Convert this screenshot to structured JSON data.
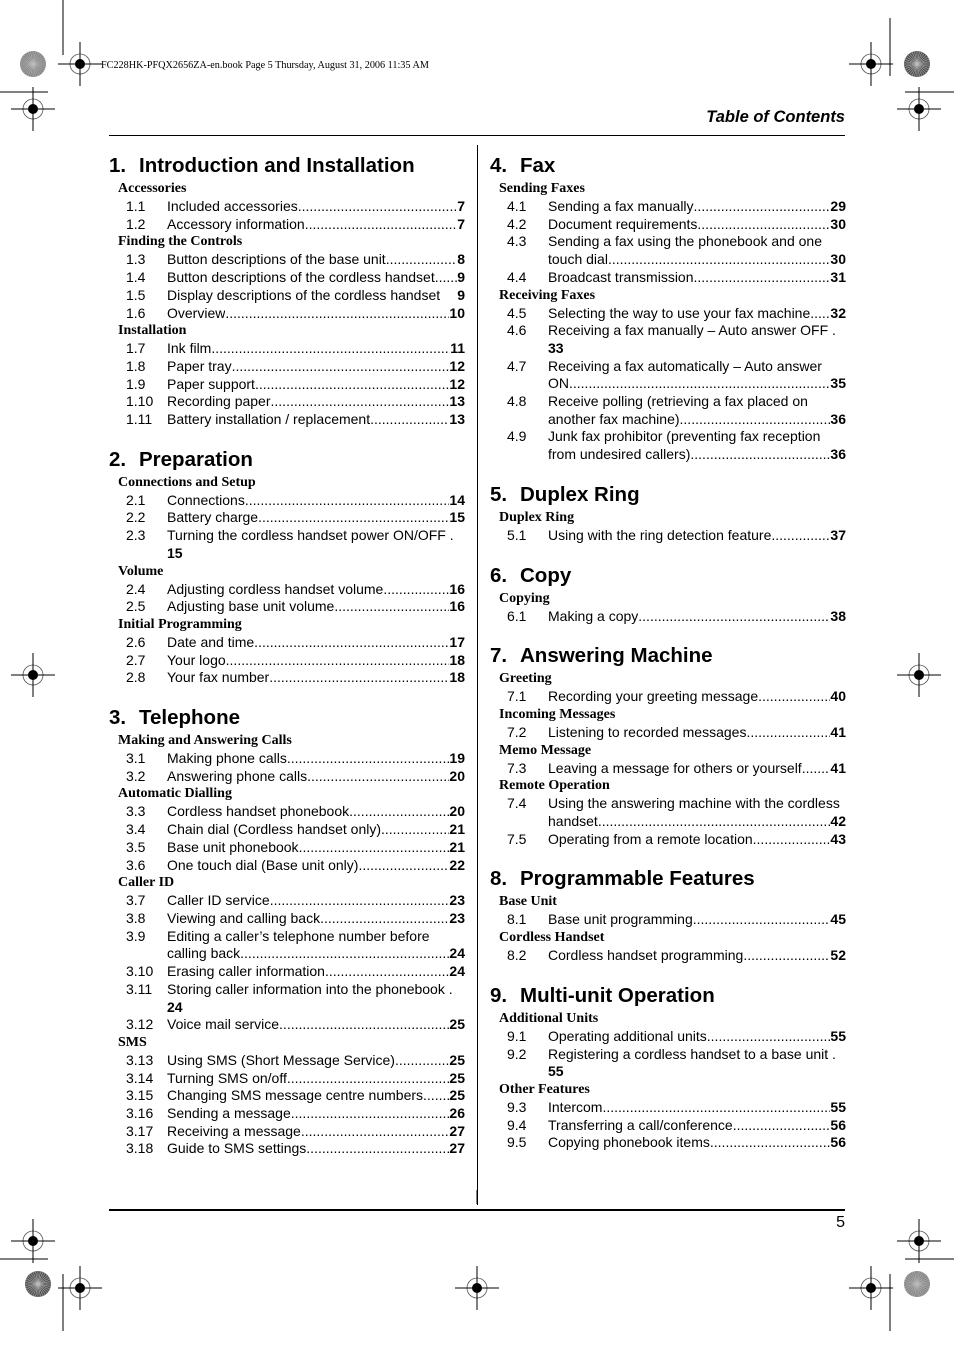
{
  "header": {
    "book_line": "FC228HK-PFQX2656ZA-en.book  Page 5  Thursday, August 31, 2006  11:35 AM",
    "title": "Table of Contents"
  },
  "footer": {
    "page_number": "5"
  },
  "left_column": [
    {
      "number": "1.",
      "title": "Introduction and Installation",
      "groups": [
        {
          "title": "Accessories",
          "entries": [
            {
              "no": "1.1",
              "text": "Included accessories",
              "page": "7"
            },
            {
              "no": "1.2",
              "text": "Accessory information",
              "page": "7"
            }
          ]
        },
        {
          "title": "Finding the Controls",
          "entries": [
            {
              "no": "1.3",
              "text": "Button descriptions of the base unit ",
              "page": "8"
            },
            {
              "no": "1.4",
              "text": "Button descriptions of the cordless handset",
              "page": "9"
            },
            {
              "no": "1.5",
              "text": "Display descriptions of the cordless handset ",
              "page": "9",
              "nodots": true
            },
            {
              "no": "1.6",
              "text": "Overview ",
              "page": "10"
            }
          ]
        },
        {
          "title": "Installation",
          "entries": [
            {
              "no": "1.7",
              "text": "Ink film",
              "page": "11"
            },
            {
              "no": "1.8",
              "text": "Paper tray ",
              "page": "12"
            },
            {
              "no": "1.9",
              "text": "Paper support",
              "page": "12"
            },
            {
              "no": "1.10",
              "text": "Recording paper",
              "page": "13"
            },
            {
              "no": "1.11",
              "text": "Battery installation / replacement ",
              "page": "13"
            }
          ]
        }
      ]
    },
    {
      "number": "2.",
      "title": "Preparation",
      "groups": [
        {
          "title": "Connections and Setup",
          "entries": [
            {
              "no": "2.1",
              "text": "Connections ",
              "page": "14"
            },
            {
              "no": "2.2",
              "text": "Battery charge",
              "page": "15"
            },
            {
              "no": "2.3",
              "text": "Turning the cordless handset power ON/OFF .",
              "page": "15",
              "page_next_line": true
            }
          ]
        },
        {
          "title": "Volume",
          "entries": [
            {
              "no": "2.4",
              "text": "Adjusting cordless handset volume ",
              "page": "16"
            },
            {
              "no": "2.5",
              "text": "Adjusting base unit volume",
              "page": "16"
            }
          ]
        },
        {
          "title": "Initial Programming",
          "entries": [
            {
              "no": "2.6",
              "text": "Date and time ",
              "page": "17"
            },
            {
              "no": "2.7",
              "text": "Your logo",
              "page": "18"
            },
            {
              "no": "2.8",
              "text": "Your fax number ",
              "page": "18"
            }
          ]
        }
      ]
    },
    {
      "number": "3.",
      "title": "Telephone",
      "groups": [
        {
          "title": "Making and Answering Calls",
          "entries": [
            {
              "no": "3.1",
              "text": "Making phone calls",
              "page": "19"
            },
            {
              "no": "3.2",
              "text": "Answering phone calls",
              "page": "20"
            }
          ]
        },
        {
          "title": "Automatic Dialling",
          "entries": [
            {
              "no": "3.3",
              "text": "Cordless handset phonebook",
              "page": "20"
            },
            {
              "no": "3.4",
              "text": "Chain dial (Cordless handset only) ",
              "page": "21"
            },
            {
              "no": "3.5",
              "text": "Base unit phonebook",
              "page": "21"
            },
            {
              "no": "3.6",
              "text": "One touch dial (Base unit only) ",
              "page": "22"
            }
          ]
        },
        {
          "title": "Caller ID",
          "entries": [
            {
              "no": "3.7",
              "text": "Caller ID service",
              "page": "23"
            },
            {
              "no": "3.8",
              "text": "Viewing and calling back ",
              "page": "23"
            },
            {
              "no": "3.9",
              "text": "Editing a caller’s telephone number before",
              "text2": "calling back",
              "page": "24"
            },
            {
              "no": "3.10",
              "text": "Erasing caller information",
              "page": "24"
            },
            {
              "no": "3.11",
              "text": "Storing caller information into the phonebook .",
              "page": "24",
              "page_next_line": true
            },
            {
              "no": "3.12",
              "text": "Voice mail service",
              "page": "25"
            }
          ]
        },
        {
          "title": "SMS",
          "entries": [
            {
              "no": "3.13",
              "text": "Using SMS (Short Message Service)",
              "page": "25"
            },
            {
              "no": "3.14",
              "text": "Turning SMS on/off",
              "page": "25"
            },
            {
              "no": "3.15",
              "text": "Changing SMS message centre numbers",
              "page": "25"
            },
            {
              "no": "3.16",
              "text": "Sending a message",
              "page": "26"
            },
            {
              "no": "3.17",
              "text": "Receiving a message ",
              "page": "27"
            },
            {
              "no": "3.18",
              "text": "Guide to SMS settings",
              "page": "27"
            }
          ]
        }
      ]
    }
  ],
  "right_column": [
    {
      "number": "4.",
      "title": "Fax",
      "groups": [
        {
          "title": "Sending Faxes",
          "entries": [
            {
              "no": "4.1",
              "text": "Sending a fax manually",
              "page": "29"
            },
            {
              "no": "4.2",
              "text": "Document requirements",
              "page": "30"
            },
            {
              "no": "4.3",
              "text": "Sending a fax using the phonebook and one",
              "text2": "touch dial",
              "page": "30"
            },
            {
              "no": "4.4",
              "text": "Broadcast transmission",
              "page": "31"
            }
          ]
        },
        {
          "title": "Receiving Faxes",
          "entries": [
            {
              "no": "4.5",
              "text": "Selecting the way to use your fax machine ",
              "page": "32"
            },
            {
              "no": "4.6",
              "text": "Receiving a fax manually – Auto answer OFF .",
              "page": "33",
              "page_next_line": true
            },
            {
              "no": "4.7",
              "text": "Receiving a fax automatically – Auto answer",
              "text2": "ON",
              "page": "35"
            },
            {
              "no": "4.8",
              "text": "Receive polling (retrieving a fax placed on",
              "text2": "another fax machine) ",
              "page": "36"
            },
            {
              "no": "4.9",
              "text": "Junk fax prohibitor (preventing fax reception",
              "text2": "from undesired callers)",
              "page": "36"
            }
          ]
        }
      ]
    },
    {
      "number": "5.",
      "title": "Duplex Ring",
      "groups": [
        {
          "title": "Duplex Ring",
          "entries": [
            {
              "no": "5.1",
              "text": "Using with the ring detection feature",
              "page": "37"
            }
          ]
        }
      ]
    },
    {
      "number": "6.",
      "title": "Copy",
      "groups": [
        {
          "title": "Copying",
          "entries": [
            {
              "no": "6.1",
              "text": "Making a copy ",
              "page": "38"
            }
          ]
        }
      ]
    },
    {
      "number": "7.",
      "title": "Answering Machine",
      "groups": [
        {
          "title": "Greeting",
          "entries": [
            {
              "no": "7.1",
              "text": "Recording your greeting message ",
              "page": "40"
            }
          ]
        },
        {
          "title": "Incoming Messages",
          "entries": [
            {
              "no": "7.2",
              "text": "Listening to recorded messages ",
              "page": "41"
            }
          ]
        },
        {
          "title": "Memo Message",
          "entries": [
            {
              "no": "7.3",
              "text": "Leaving a message for others or yourself ",
              "page": "41"
            }
          ]
        },
        {
          "title": "Remote Operation",
          "entries": [
            {
              "no": "7.4",
              "text": "Using the answering machine with the cordless",
              "text2": "handset ",
              "page": "42"
            },
            {
              "no": "7.5",
              "text": "Operating from a remote location",
              "page": "43"
            }
          ]
        }
      ]
    },
    {
      "number": "8.",
      "title": "Programmable Features",
      "groups": [
        {
          "title": "Base Unit",
          "entries": [
            {
              "no": "8.1",
              "text": "Base unit programming",
              "page": "45"
            }
          ]
        },
        {
          "title": "Cordless Handset",
          "entries": [
            {
              "no": "8.2",
              "text": "Cordless handset programming",
              "page": "52"
            }
          ]
        }
      ]
    },
    {
      "number": "9.",
      "title": "Multi-unit Operation",
      "groups": [
        {
          "title": "Additional Units",
          "entries": [
            {
              "no": "9.1",
              "text": "Operating additional units ",
              "page": "55"
            },
            {
              "no": "9.2",
              "text": "Registering a cordless handset to a base unit .",
              "page": "55",
              "page_next_line": true
            }
          ]
        },
        {
          "title": "Other Features",
          "entries": [
            {
              "no": "9.3",
              "text": "Intercom ",
              "page": "55"
            },
            {
              "no": "9.4",
              "text": "Transferring a call/conference ",
              "page": "56"
            },
            {
              "no": "9.5",
              "text": "Copying phonebook items",
              "page": "56"
            }
          ]
        }
      ]
    }
  ]
}
